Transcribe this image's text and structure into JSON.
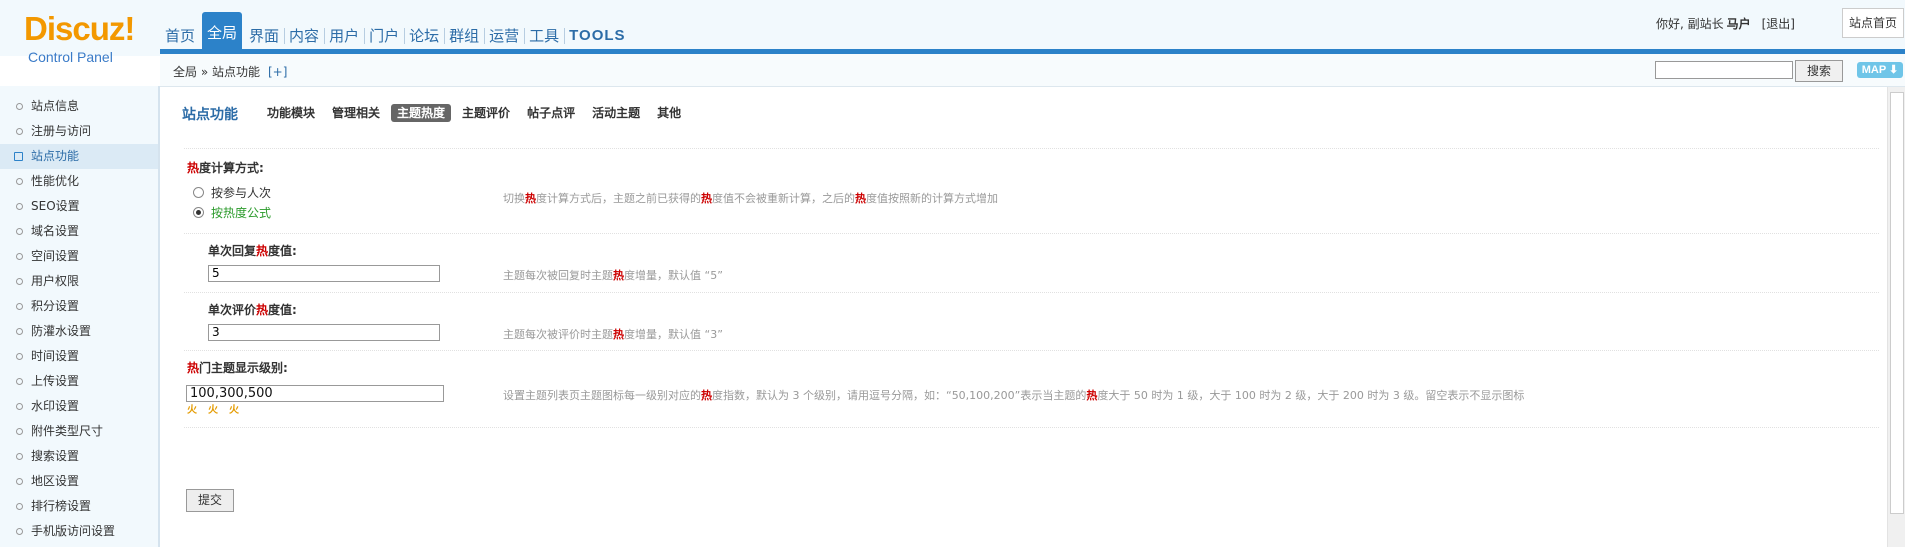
{
  "logo": {
    "brand": "Discuz!",
    "subtitle": "Control Panel"
  },
  "nav": [
    {
      "label": "首页"
    },
    {
      "label": "全局"
    },
    {
      "label": "界面"
    },
    {
      "label": "内容"
    },
    {
      "label": "用户"
    },
    {
      "label": "门户"
    },
    {
      "label": "论坛"
    },
    {
      "label": "群组"
    },
    {
      "label": "运营"
    },
    {
      "label": "工具"
    },
    {
      "label": "TOOLS"
    }
  ],
  "user": {
    "greeting": "你好, 副站长",
    "name": "马户",
    "logout": "[退出]",
    "home": "站点首页"
  },
  "subbar": {
    "crumb": "全局 » 站点功能",
    "plus": "[+]",
    "search_placeholder": "",
    "search_button": "搜索",
    "map": "MAP ⬇"
  },
  "sidebar": {
    "items": [
      {
        "label": "站点信息"
      },
      {
        "label": "注册与访问"
      },
      {
        "label": "站点功能"
      },
      {
        "label": "性能优化"
      },
      {
        "label": "SEO设置"
      },
      {
        "label": "域名设置"
      },
      {
        "label": "空间设置"
      },
      {
        "label": "用户权限"
      },
      {
        "label": "积分设置"
      },
      {
        "label": "防灌水设置"
      },
      {
        "label": "时间设置"
      },
      {
        "label": "上传设置"
      },
      {
        "label": "水印设置"
      },
      {
        "label": "附件类型尺寸"
      },
      {
        "label": "搜索设置"
      },
      {
        "label": "地区设置"
      },
      {
        "label": "排行榜设置"
      },
      {
        "label": "手机版访问设置"
      }
    ]
  },
  "main": {
    "title": "站点功能",
    "tabs": [
      {
        "label": "功能模块"
      },
      {
        "label": "管理相关"
      },
      {
        "label": "主题热度"
      },
      {
        "label": "主题评价"
      },
      {
        "label": "帖子点评"
      },
      {
        "label": "活动主题"
      },
      {
        "label": "其他"
      }
    ],
    "calc": {
      "hot": "热",
      "label": "度计算方式:",
      "option1": "按参与人次",
      "option2": "按热度公式",
      "tip_a": "切换",
      "tip_hot": "热",
      "tip_b": "度计算方式后，主题之前已获得的",
      "tip_c": "度值不会被重新计算，之后的",
      "tip_d": "度值按照新的计算方式增加"
    },
    "reply": {
      "label_a": "单次回复",
      "hot": "热",
      "label_b": "度值:",
      "value": "5",
      "tip_a": "主题每次被回复时主题",
      "tip_hot": "热",
      "tip_b": "度增量，默认值 “5”"
    },
    "rate": {
      "label_a": "单次评价",
      "hot": "热",
      "label_b": "度值:",
      "value": "3",
      "tip_a": "主题每次被评价时主题",
      "tip_hot": "热",
      "tip_b": "度增量，默认值 “3”"
    },
    "levels": {
      "hot": "热",
      "label": "门主题显示级别:",
      "value": "100,300,500",
      "fire": "火",
      "tip_a": "设置主题列表页主题图标每一级别对应的",
      "tip_hot": "热",
      "tip_b": "度指数，默认为 3 个级别，请用逗号分隔，如：“50,100,200”表示当主题的",
      "tip_c": "度大于 50 时为 1 级，大于 100 时为 2 级，大于 200 时为 3 级。留空表示不显示图标"
    },
    "submit": "提交"
  }
}
